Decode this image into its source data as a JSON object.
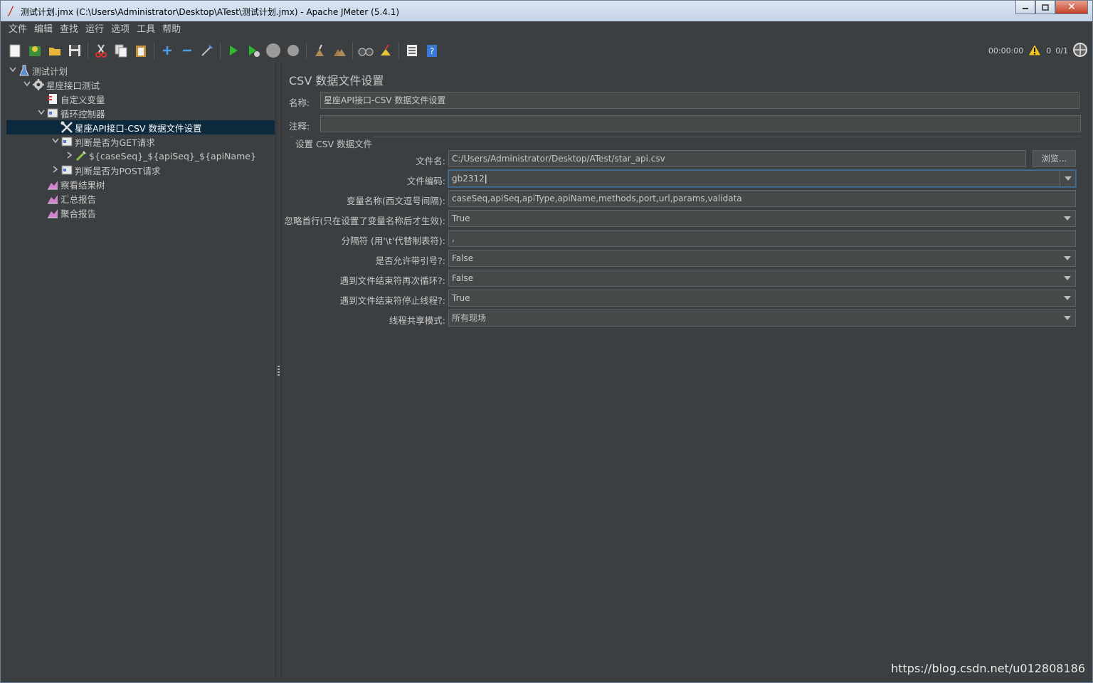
{
  "window": {
    "title": "测试计划.jmx (C:\\Users\\Administrator\\Desktop\\ATest\\测试计划.jmx) - Apache JMeter (5.4.1)"
  },
  "menu": [
    "文件",
    "编辑",
    "查找",
    "运行",
    "选项",
    "工具",
    "帮助"
  ],
  "toolbar_status": {
    "timer": "00:00:00",
    "warnings": "0",
    "threads": "0/1"
  },
  "tree": [
    {
      "label": "测试计划",
      "icon": "flask-icon",
      "level": 0,
      "arrow": "down"
    },
    {
      "label": "星座接口测试",
      "icon": "gear-icon",
      "level": 1,
      "arrow": "down"
    },
    {
      "label": "自定义变量",
      "icon": "config-doc-icon",
      "level": 2,
      "arrow": ""
    },
    {
      "label": "循环控制器",
      "icon": "controller-icon",
      "level": 2,
      "arrow": "down"
    },
    {
      "label": "星座API接口-CSV 数据文件设置",
      "icon": "tools-icon",
      "level": 3,
      "arrow": "",
      "selected": true
    },
    {
      "label": "判断是否为GET请求",
      "icon": "controller-icon",
      "level": 3,
      "arrow": "down"
    },
    {
      "label": "${caseSeq}_${apiSeq}_${apiName}",
      "icon": "pipette-icon",
      "level": 4,
      "arrow": "right"
    },
    {
      "label": "判断是否为POST请求",
      "icon": "controller-icon",
      "level": 3,
      "arrow": "right"
    },
    {
      "label": "察看结果树",
      "icon": "chart-icon",
      "level": 2,
      "arrow": ""
    },
    {
      "label": "汇总报告",
      "icon": "chart-icon",
      "level": 2,
      "arrow": ""
    },
    {
      "label": "聚合报告",
      "icon": "chart-icon",
      "level": 2,
      "arrow": ""
    }
  ],
  "panel": {
    "title": "CSV 数据文件设置",
    "name_label": "名称:",
    "name_value": "星座API接口-CSV 数据文件设置",
    "comment_label": "注释:",
    "comment_value": "",
    "group_title": "设置 CSV 数据文件",
    "filename_label": "文件名:",
    "filename_value": "C:/Users/Administrator/Desktop/ATest/star_api.csv",
    "browse_label": "浏览...",
    "encoding_label": "文件编码:",
    "encoding_value": "gb2312",
    "varnames_label": "变量名称(西文逗号间隔):",
    "varnames_value": "caseSeq,apiSeq,apiType,apiName,methods,port,url,params,validata",
    "ignore_first_label": "忽略首行(只在设置了变量名称后才生效):",
    "ignore_first_value": "True",
    "delimiter_label": "分隔符 (用'\\t'代替制表符):",
    "delimiter_value": ",",
    "quoted_label": "是否允许带引号?:",
    "quoted_value": "False",
    "recycle_label": "遇到文件结束符再次循环?:",
    "recycle_value": "False",
    "stop_label": "遇到文件结束符停止线程?:",
    "stop_value": "True",
    "share_label": "线程共享模式:",
    "share_value": "所有现场"
  },
  "watermark": "https://blog.csdn.net/u012808186"
}
